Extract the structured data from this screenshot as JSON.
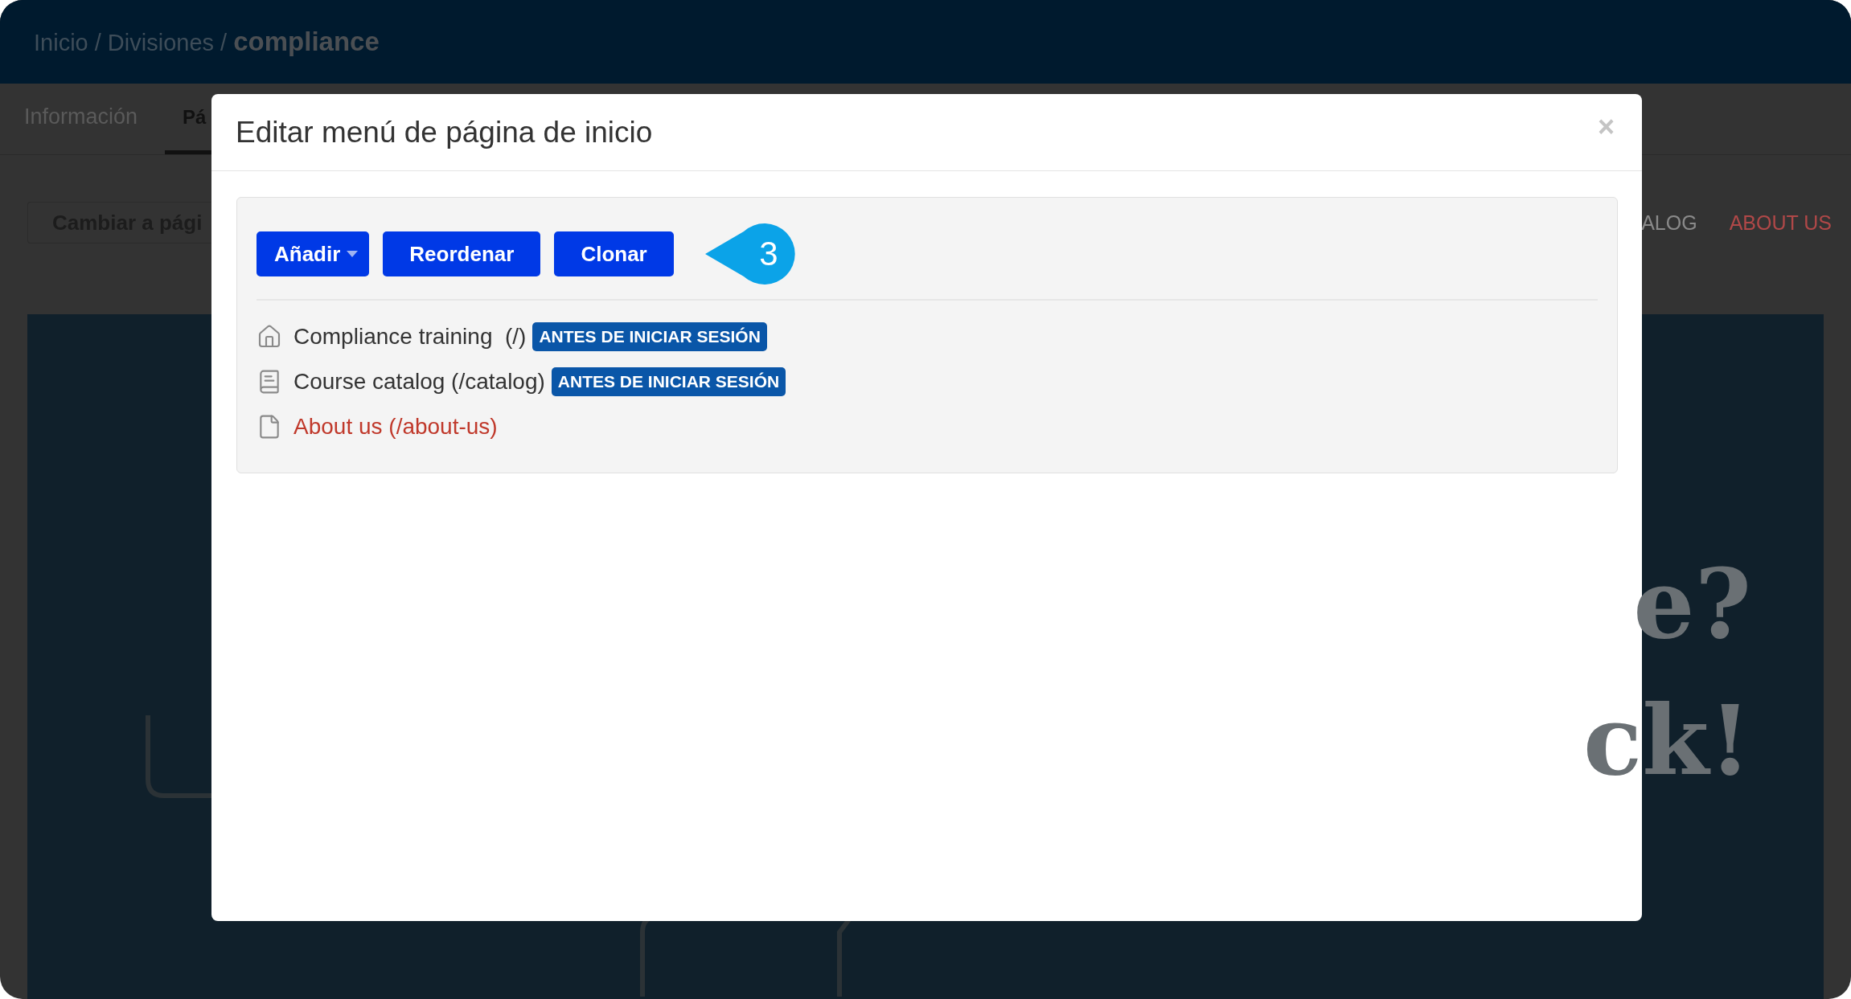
{
  "header": {
    "breadcrumb": "Inicio / Divisiones / **compliance**"
  },
  "tabs": [
    {
      "label": "Información",
      "selected": false
    },
    {
      "label": "Pá",
      "selected": true
    }
  ],
  "toolbar": {
    "button": "Cambiar a pági",
    "links": [
      "ALOG",
      "ABOUT US"
    ]
  },
  "hero": {
    "lines": [
      "e?",
      "ck!"
    ]
  },
  "modal": {
    "title": "Editar menú de página de inicio",
    "close": "×",
    "buttons": [
      {
        "label": "Añadir",
        "dropdown": true
      },
      {
        "label": "Reordenar",
        "dropdown": false
      },
      {
        "label": "Clonar",
        "dropdown": false
      }
    ],
    "step": "3",
    "items": [
      {
        "kind": "home",
        "label": "Compliance training  (/)",
        "badge": "ANTES DE INICIAR SESIÓN",
        "color": "#333333"
      },
      {
        "kind": "book",
        "label": "Course catalog (/catalog)",
        "badge": "ANTES DE INICIAR SESIÓN",
        "color": "#333333"
      },
      {
        "kind": "page",
        "label": "About us (/about-us)",
        "color": "#c0392b"
      }
    ]
  }
}
